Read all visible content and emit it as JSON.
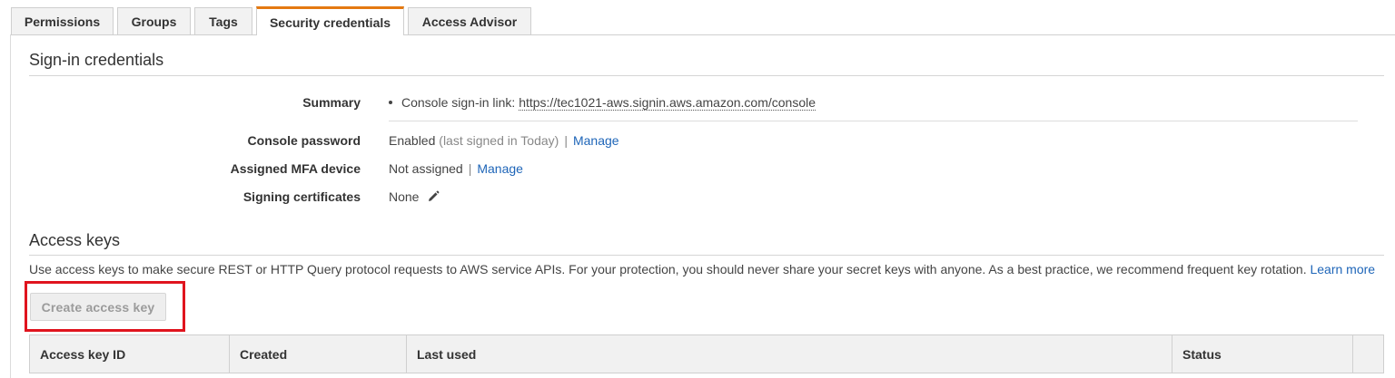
{
  "tabs": [
    {
      "label": "Permissions"
    },
    {
      "label": "Groups"
    },
    {
      "label": "Tags"
    },
    {
      "label": "Security credentials",
      "active": true
    },
    {
      "label": "Access Advisor"
    }
  ],
  "signin": {
    "title": "Sign-in credentials",
    "summary_label": "Summary",
    "summary_prefix": "Console sign-in link:",
    "summary_link": "https://tec1021-aws.signin.aws.amazon.com/console",
    "password_label": "Console password",
    "password_value": "Enabled",
    "password_note": "(last signed in Today)",
    "password_action": "Manage",
    "mfa_label": "Assigned MFA device",
    "mfa_value": "Not assigned",
    "mfa_action": "Manage",
    "certs_label": "Signing certificates",
    "certs_value": "None",
    "separator": "|"
  },
  "access_keys": {
    "title": "Access keys",
    "description": "Use access keys to make secure REST or HTTP Query protocol requests to AWS service APIs. For your protection, you should never share your secret keys with anyone. As a best practice, we recommend frequent key rotation.",
    "learn_more": "Learn more",
    "create_button": "Create access key",
    "columns": [
      "Access key ID",
      "Created",
      "Last used",
      "Status"
    ]
  },
  "colors": {
    "active_tab_accent": "#e47911",
    "link": "#1e65b8",
    "highlight": "#e0141e"
  },
  "icons": {
    "edit": "pencil-icon"
  }
}
